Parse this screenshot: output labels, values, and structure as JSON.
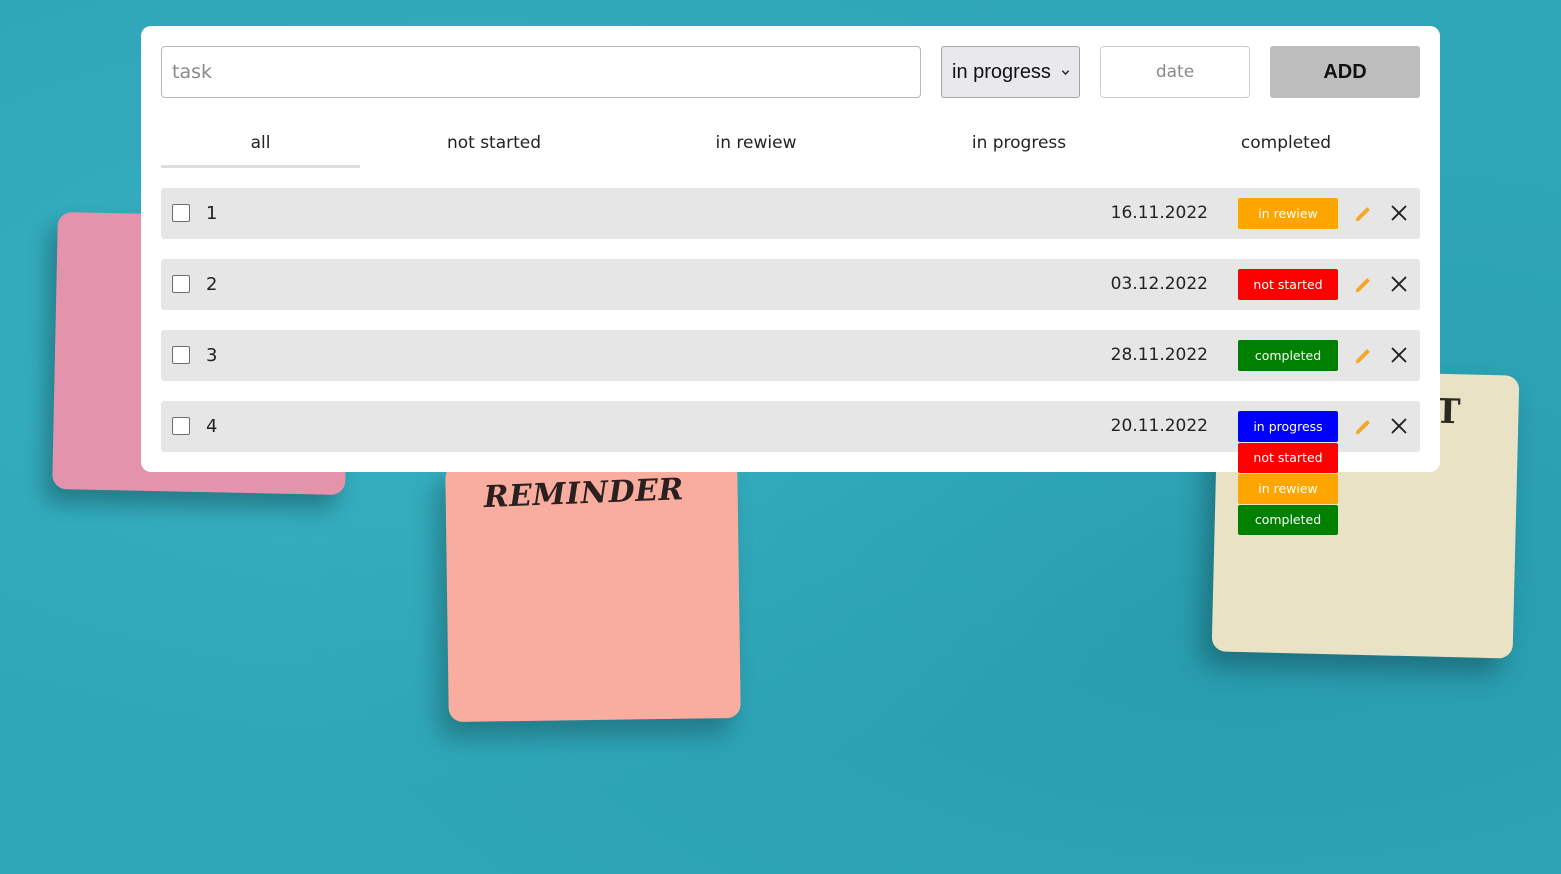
{
  "background": {
    "reminder_note_text": "REMINDER",
    "cream_note_partial_text": "T"
  },
  "form": {
    "task_placeholder": "task",
    "task_value": "",
    "status_selected": "in progress",
    "date_placeholder": "date",
    "date_value": "",
    "add_label": "ADD"
  },
  "filters": {
    "active": "all",
    "tabs": [
      {
        "label": "all"
      },
      {
        "label": "not started"
      },
      {
        "label": "in rewiew"
      },
      {
        "label": "in progress"
      },
      {
        "label": "completed"
      }
    ]
  },
  "tasks": [
    {
      "name": "1",
      "date": "16.11.2022",
      "status": "in rewiew",
      "checked": false
    },
    {
      "name": "2",
      "date": "03.12.2022",
      "status": "not started",
      "checked": false
    },
    {
      "name": "3",
      "date": "28.11.2022",
      "status": "completed",
      "checked": false
    },
    {
      "name": "4",
      "date": "20.11.2022",
      "status": "in progress",
      "checked": false
    }
  ],
  "status_dropdown": {
    "options": [
      {
        "label": "not started"
      },
      {
        "label": "in rewiew"
      },
      {
        "label": "completed"
      }
    ]
  },
  "status_colors": {
    "not_started": "#ff0000",
    "in_rewiew": "#ffa500",
    "in_progress": "#0000ff",
    "completed": "#008000"
  },
  "colors": {
    "edit_icon": "#f5a623",
    "delete_icon": "#222222",
    "background": "#2fa6b8"
  },
  "icons": {
    "edit": "pencil-icon",
    "delete": "close-icon",
    "select": "chevron-down-icon"
  }
}
